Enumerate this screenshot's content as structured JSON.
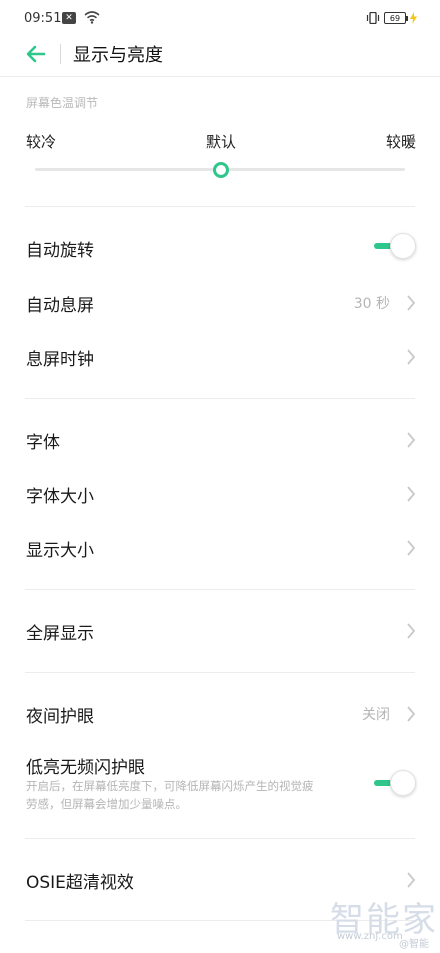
{
  "status_bar": {
    "time": "09:51",
    "battery": "69"
  },
  "header": {
    "title": "显示与亮度"
  },
  "color_temperature": {
    "section_label": "屏幕色温调节",
    "left_label": "较冷",
    "center_label": "默认",
    "right_label": "较暖",
    "value": 0.5
  },
  "settings": {
    "auto_rotate": {
      "label": "自动旋转",
      "enabled": true
    },
    "screen_timeout": {
      "label": "自动息屏",
      "value": "30 秒"
    },
    "aod_clock": {
      "label": "息屏时钟"
    },
    "font": {
      "label": "字体"
    },
    "font_size": {
      "label": "字体大小"
    },
    "display_size": {
      "label": "显示大小"
    },
    "full_screen": {
      "label": "全屏显示"
    },
    "night_mode": {
      "label": "夜间护眼",
      "value": "关闭"
    },
    "low_flicker": {
      "label": "低亮无频闪护眼",
      "desc_line1": "开启后，在屏幕低亮度下，可降低屏幕闪烁产生的视觉疲",
      "desc_line2": "劳感，但屏幕会增加少量噪点。",
      "enabled": true
    },
    "osie": {
      "label": "OSIE超清视效"
    }
  },
  "watermark": {
    "brand": "智能家",
    "url": "www.znj.com",
    "weibo": "@智能"
  },
  "colors": {
    "accent": "#2ec68a"
  }
}
